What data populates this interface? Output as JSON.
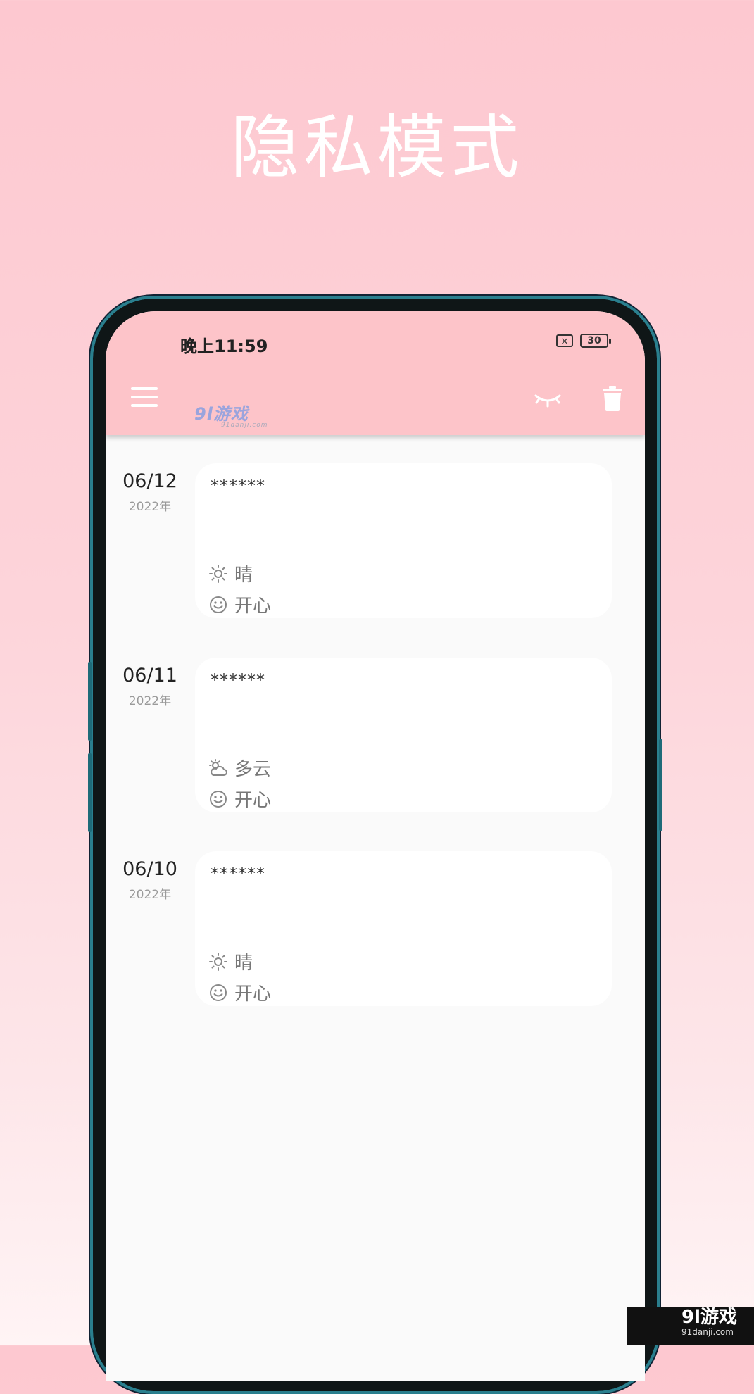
{
  "headline": "隐私模式",
  "status_bar": {
    "time": "晚上11:59",
    "battery": "30",
    "sim_mark": "×"
  },
  "watermark": {
    "brand": "9l游戏",
    "site": "91danji.com"
  },
  "entries": [
    {
      "date": "06/12",
      "year": "2022年",
      "content": "******",
      "weather": "晴",
      "weather_icon": "sun-icon",
      "mood": "开心",
      "mood_icon": "smile-icon"
    },
    {
      "date": "06/11",
      "year": "2022年",
      "content": "******",
      "weather": "多云",
      "weather_icon": "cloudy-icon",
      "mood": "开心",
      "mood_icon": "smile-icon"
    },
    {
      "date": "06/10",
      "year": "2022年",
      "content": "******",
      "weather": "晴",
      "weather_icon": "sun-icon",
      "mood": "开心",
      "mood_icon": "smile-icon"
    }
  ],
  "corner_badge": {
    "brand": "9l游戏",
    "site": "91danji.com"
  },
  "colors": {
    "appbar": "#fdc4c9",
    "background_top": "#fdc8d0",
    "card": "#ffffff"
  }
}
